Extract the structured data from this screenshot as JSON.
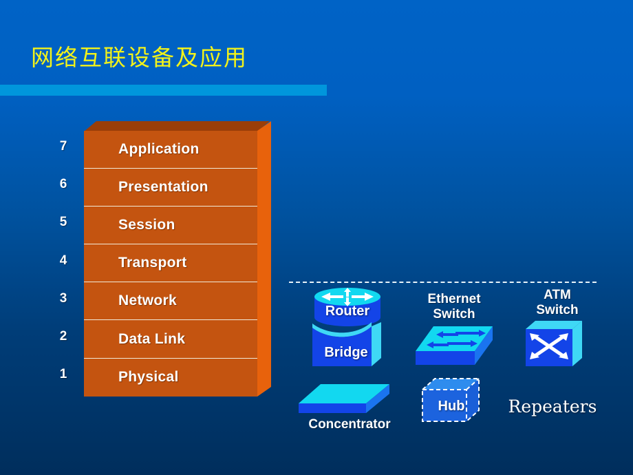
{
  "slide": {
    "title": "网络互联设备及应用",
    "background_top_color": "#0063C6",
    "background_bottom_color": "#002E5C",
    "accent_bar_color": "#0096DC",
    "title_color": "#F2F21A"
  },
  "osi": {
    "box_face_color": "#C45410",
    "box_side_color": "#E8620C",
    "box_top_color": "#9A3E09",
    "layers": [
      {
        "number": "7",
        "label": "Application"
      },
      {
        "number": "6",
        "label": "Presentation"
      },
      {
        "number": "5",
        "label": "Session"
      },
      {
        "number": "4",
        "label": "Transport"
      },
      {
        "number": "3",
        "label": "Network"
      },
      {
        "number": "2",
        "label": "Data Link"
      },
      {
        "number": "1",
        "label": "Physical"
      }
    ]
  },
  "devices": {
    "router": {
      "label": "Router",
      "icon": "router-cylinder-icon"
    },
    "bridge": {
      "label": "Bridge",
      "icon": "bridge-box-icon"
    },
    "ethernet_switch": {
      "label_line1": "Ethernet",
      "label_line2": "Switch",
      "icon": "ethernet-switch-icon"
    },
    "atm_switch": {
      "label_line1": "ATM",
      "label_line2": "Switch",
      "icon": "atm-switch-cube-icon"
    },
    "concentrator": {
      "label": "Concentrator",
      "icon": "concentrator-slab-icon"
    },
    "hub": {
      "label": "Hub",
      "icon": "hub-cube-icon"
    },
    "repeaters": {
      "label": "Repeaters"
    }
  }
}
